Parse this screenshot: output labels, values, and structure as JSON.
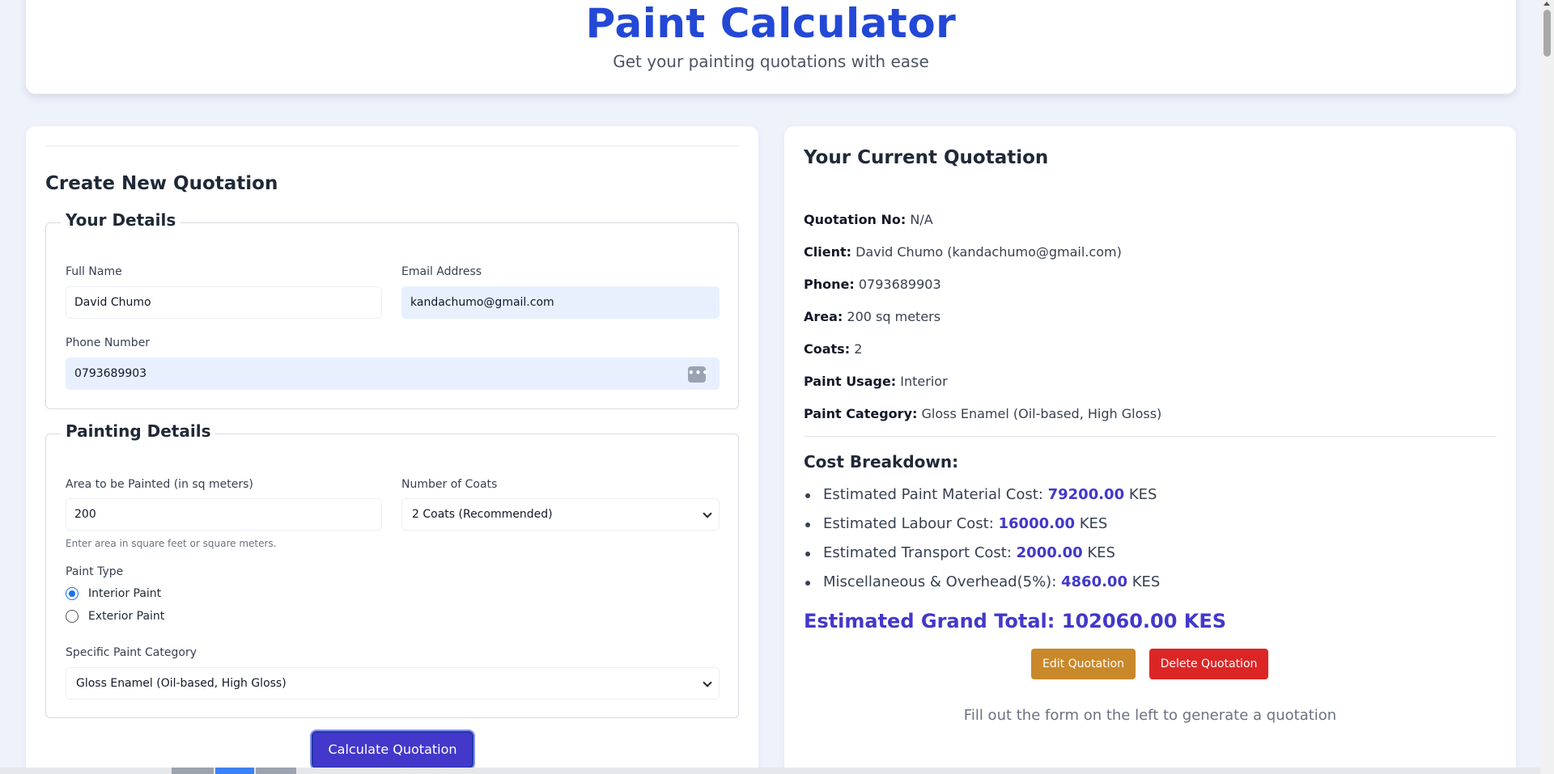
{
  "header": {
    "title": "Paint Calculator",
    "subtitle": "Get your painting quotations with ease"
  },
  "form": {
    "title": "Create New Quotation",
    "your_details": {
      "legend": "Your Details",
      "full_name_label": "Full Name",
      "full_name_value": "David Chumo",
      "email_label": "Email Address",
      "email_value": "kandachumo@gmail.com",
      "phone_label": "Phone Number",
      "phone_value": "0793689903"
    },
    "painting_details": {
      "legend": "Painting Details",
      "area_label": "Area to be Painted (in sq meters)",
      "area_value": "200",
      "area_hint": "Enter area in square feet or square meters.",
      "coats_label": "Number of Coats",
      "coats_value": "2 Coats (Recommended)",
      "paint_type_label": "Paint Type",
      "paint_type_options": [
        "Interior Paint",
        "Exterior Paint"
      ],
      "paint_type_selected": "Interior Paint",
      "category_label": "Specific Paint Category",
      "category_value": "Gloss Enamel (Oil-based, High Gloss)"
    },
    "calculate_label": "Calculate Quotation"
  },
  "quotation": {
    "title": "Your Current Quotation",
    "rows": [
      {
        "label": "Quotation No:",
        "value": "N/A"
      },
      {
        "label": "Client:",
        "value": "David Chumo (kandachumo@gmail.com)"
      },
      {
        "label": "Phone:",
        "value": "0793689903"
      },
      {
        "label": "Area:",
        "value": "200 sq meters"
      },
      {
        "label": "Coats:",
        "value": "2"
      },
      {
        "label": "Paint Usage:",
        "value": "Interior"
      },
      {
        "label": "Paint Category:",
        "value": "Gloss Enamel (Oil-based, High Gloss)"
      }
    ],
    "cost_title": "Cost Breakdown:",
    "costs": [
      {
        "label": "Estimated Paint Material Cost:",
        "amount": "79200.00",
        "unit": "KES"
      },
      {
        "label": "Estimated Labour Cost:",
        "amount": "16000.00",
        "unit": "KES"
      },
      {
        "label": "Estimated Transport Cost:",
        "amount": "2000.00",
        "unit": "KES"
      },
      {
        "label": "Miscellaneous & Overhead(5%):",
        "amount": "4860.00",
        "unit": "KES"
      }
    ],
    "grand_total": "Estimated Grand Total: 102060.00 KES",
    "edit_label": "Edit Quotation",
    "delete_label": "Delete Quotation",
    "note": "Fill out the form on the left to generate a quotation"
  },
  "colors": {
    "accent": "#2348d6",
    "primary": "#4338ca",
    "edit": "#c9882a",
    "delete": "#dc2626"
  }
}
